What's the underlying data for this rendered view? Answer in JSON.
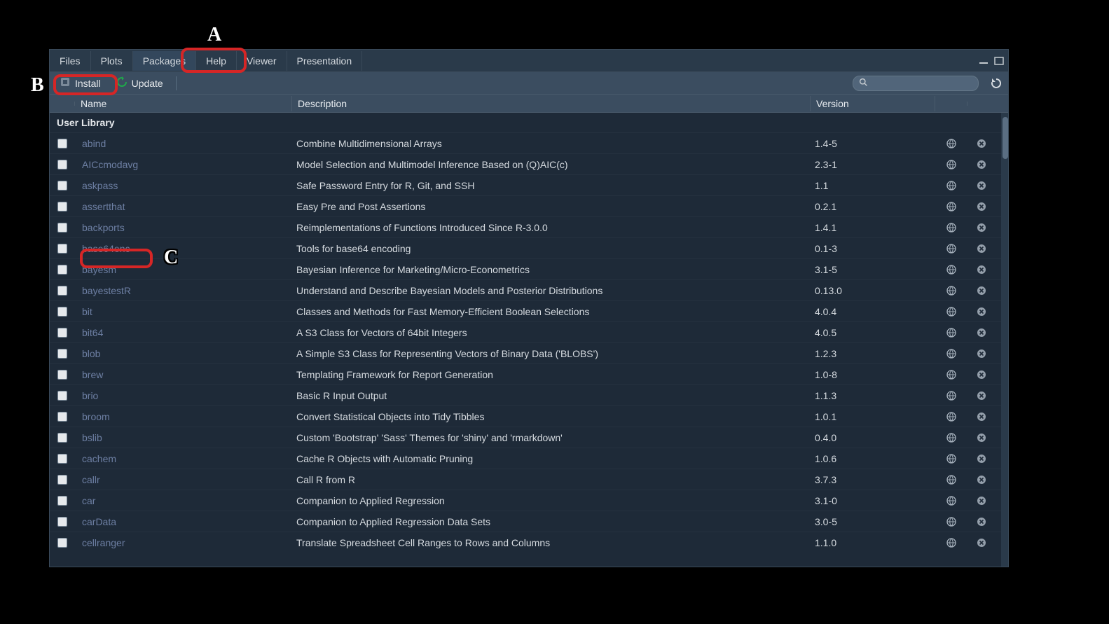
{
  "tabs": [
    "Files",
    "Plots",
    "Packages",
    "Help",
    "Viewer",
    "Presentation"
  ],
  "active_tab_index": 2,
  "toolbar": {
    "install_label": "Install",
    "update_label": "Update"
  },
  "columns": {
    "name": "Name",
    "description": "Description",
    "version": "Version"
  },
  "group_label": "User Library",
  "packages": [
    {
      "name": "abind",
      "desc": "Combine Multidimensional Arrays",
      "ver": "1.4-5"
    },
    {
      "name": "AICcmodavg",
      "desc": "Model Selection and Multimodel Inference Based on (Q)AIC(c)",
      "ver": "2.3-1"
    },
    {
      "name": "askpass",
      "desc": "Safe Password Entry for R, Git, and SSH",
      "ver": "1.1"
    },
    {
      "name": "assertthat",
      "desc": "Easy Pre and Post Assertions",
      "ver": "0.2.1"
    },
    {
      "name": "backports",
      "desc": "Reimplementations of Functions Introduced Since R-3.0.0",
      "ver": "1.4.1"
    },
    {
      "name": "base64enc",
      "desc": "Tools for base64 encoding",
      "ver": "0.1-3"
    },
    {
      "name": "bayesm",
      "desc": "Bayesian Inference for Marketing/Micro-Econometrics",
      "ver": "3.1-5"
    },
    {
      "name": "bayestestR",
      "desc": "Understand and Describe Bayesian Models and Posterior Distributions",
      "ver": "0.13.0"
    },
    {
      "name": "bit",
      "desc": "Classes and Methods for Fast Memory-Efficient Boolean Selections",
      "ver": "4.0.4"
    },
    {
      "name": "bit64",
      "desc": "A S3 Class for Vectors of 64bit Integers",
      "ver": "4.0.5"
    },
    {
      "name": "blob",
      "desc": "A Simple S3 Class for Representing Vectors of Binary Data ('BLOBS')",
      "ver": "1.2.3"
    },
    {
      "name": "brew",
      "desc": "Templating Framework for Report Generation",
      "ver": "1.0-8"
    },
    {
      "name": "brio",
      "desc": "Basic R Input Output",
      "ver": "1.1.3"
    },
    {
      "name": "broom",
      "desc": "Convert Statistical Objects into Tidy Tibbles",
      "ver": "1.0.1"
    },
    {
      "name": "bslib",
      "desc": "Custom 'Bootstrap' 'Sass' Themes for 'shiny' and 'rmarkdown'",
      "ver": "0.4.0"
    },
    {
      "name": "cachem",
      "desc": "Cache R Objects with Automatic Pruning",
      "ver": "1.0.6"
    },
    {
      "name": "callr",
      "desc": "Call R from R",
      "ver": "3.7.3"
    },
    {
      "name": "car",
      "desc": "Companion to Applied Regression",
      "ver": "3.1-0"
    },
    {
      "name": "carData",
      "desc": "Companion to Applied Regression Data Sets",
      "ver": "3.0-5"
    },
    {
      "name": "cellranger",
      "desc": "Translate Spreadsheet Cell Ranges to Rows and Columns",
      "ver": "1.1.0"
    }
  ],
  "annotations": {
    "a": "A",
    "b": "B",
    "c": "C"
  }
}
